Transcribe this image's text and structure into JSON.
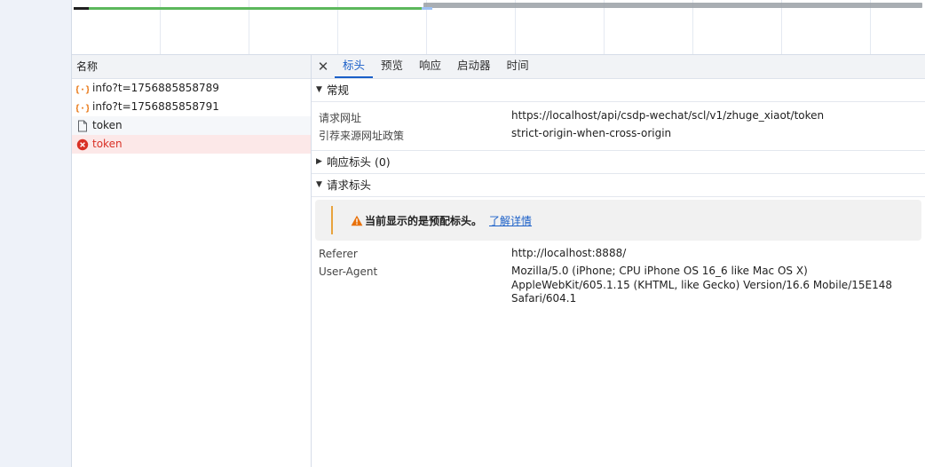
{
  "timeline": {
    "colors": {
      "waiting": "#1f1f1f",
      "download": "#5cb85c",
      "queued": "#9aa0a6"
    }
  },
  "request_list": {
    "header": "名称",
    "rows": [
      {
        "name": "info?t=1756885858789",
        "icon": "xhr-braces-icon",
        "state": "normal"
      },
      {
        "name": "info?t=1756885858791",
        "icon": "xhr-braces-icon",
        "state": "normal"
      },
      {
        "name": "token",
        "icon": "document-icon",
        "state": "normal"
      },
      {
        "name": "token",
        "icon": "error-circle-icon",
        "state": "error"
      }
    ],
    "colors": {
      "error_text": "#d93025",
      "error_bg": "#fce8e8"
    }
  },
  "details": {
    "tabs": [
      {
        "label": "标头",
        "active": true
      },
      {
        "label": "预览",
        "active": false
      },
      {
        "label": "响应",
        "active": false
      },
      {
        "label": "启动器",
        "active": false
      },
      {
        "label": "时间",
        "active": false
      }
    ],
    "general": {
      "title": "常规",
      "expanded": true,
      "rows": [
        {
          "key": "请求网址",
          "value": "https://localhost/api/csdp-wechat/scl/v1/zhuge_xiaot/token"
        },
        {
          "key": "引荐来源网址政策",
          "value": "strict-origin-when-cross-origin"
        }
      ]
    },
    "response_headers": {
      "title": "响应标头 (0)",
      "expanded": false
    },
    "request_headers": {
      "title": "请求标头",
      "expanded": true,
      "warning": {
        "text": "当前显示的是预配标头。",
        "link": "了解详情",
        "icon": "warning-triangle-icon"
      },
      "rows": [
        {
          "key": "Referer",
          "value": "http://localhost:8888/"
        },
        {
          "key": "User-Agent",
          "value": "Mozilla/5.0 (iPhone; CPU iPhone OS 16_6 like Mac OS X) AppleWebKit/605.1.15 (KHTML, like Gecko) Version/16.6 Mobile/15E148 Safari/604.1"
        }
      ]
    },
    "accent": "#1a5fc8"
  }
}
